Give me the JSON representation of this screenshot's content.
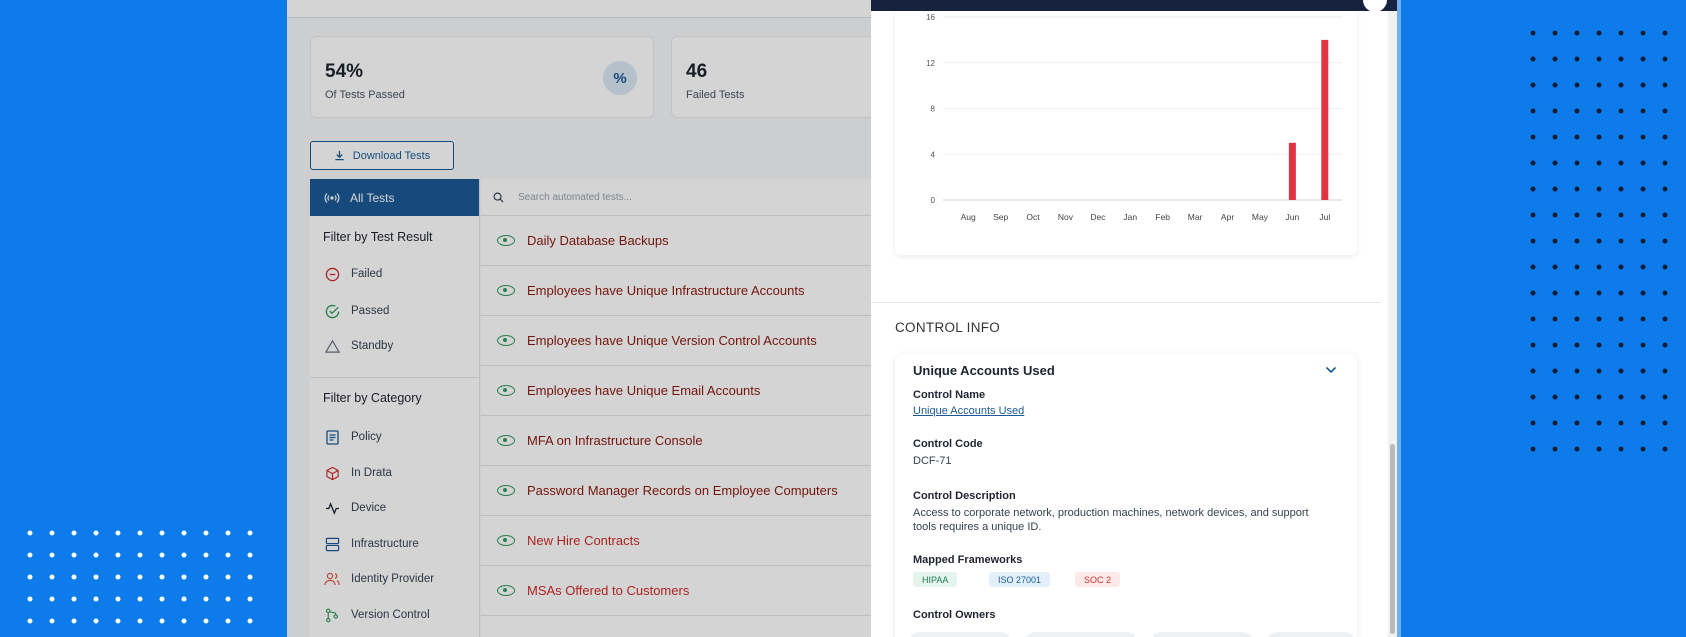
{
  "summary_cards": [
    {
      "value": "54%",
      "label": "Of Tests Passed",
      "icon": "%"
    },
    {
      "value": "46",
      "label": "Failed Tests"
    }
  ],
  "download_button": "Download Tests",
  "filters": {
    "all_tests": "All Tests",
    "by_result_heading": "Filter by Test Result",
    "results": [
      "Failed",
      "Passed",
      "Standby"
    ],
    "by_category_heading": "Filter by Category",
    "categories": [
      "Policy",
      "In Drata",
      "Device",
      "Infrastructure",
      "Identity Provider",
      "Version Control"
    ]
  },
  "search": {
    "placeholder": "Search automated tests..."
  },
  "tests": [
    {
      "name": "Daily Database Backups",
      "color": "#8b1a10"
    },
    {
      "name": "Employees have Unique Infrastructure Accounts",
      "color": "#8b1a10"
    },
    {
      "name": "Employees have Unique Version Control Accounts",
      "color": "#8b1a10"
    },
    {
      "name": "Employees have Unique Email Accounts",
      "color": "#8b1a10"
    },
    {
      "name": "MFA on Infrastructure Console",
      "color": "#8b1a10"
    },
    {
      "name": "Password Manager Records on Employee Computers",
      "color": "#8b1a10"
    },
    {
      "name": "New Hire Contracts",
      "color": "#d12b2b"
    },
    {
      "name": "MSAs Offered to Customers",
      "color": "#d12b2b"
    }
  ],
  "chart_data": {
    "type": "bar",
    "categories": [
      "Aug",
      "Sep",
      "Oct",
      "Nov",
      "Dec",
      "Jan",
      "Feb",
      "Mar",
      "Apr",
      "May",
      "Jun",
      "Jul"
    ],
    "values": [
      0,
      0,
      0,
      0,
      0,
      0,
      0,
      0,
      0,
      0,
      5,
      14
    ],
    "yticks": [
      0,
      4,
      8,
      12,
      16
    ],
    "ylim": [
      0,
      16
    ],
    "bar_color": "#e03444"
  },
  "control_info": {
    "section_title": "CONTROL INFO",
    "header": "Unique Accounts Used",
    "name_label": "Control Name",
    "name_value": "Unique Accounts Used",
    "code_label": "Control Code",
    "code_value": "DCF-71",
    "description_label": "Control Description",
    "description_value": "Access to corporate network, production machines, network devices, and support tools requires a unique ID.",
    "frameworks_label": "Mapped Frameworks",
    "frameworks": [
      "HIPAA",
      "ISO 27001",
      "SOC 2"
    ],
    "owners_label": "Control Owners"
  }
}
